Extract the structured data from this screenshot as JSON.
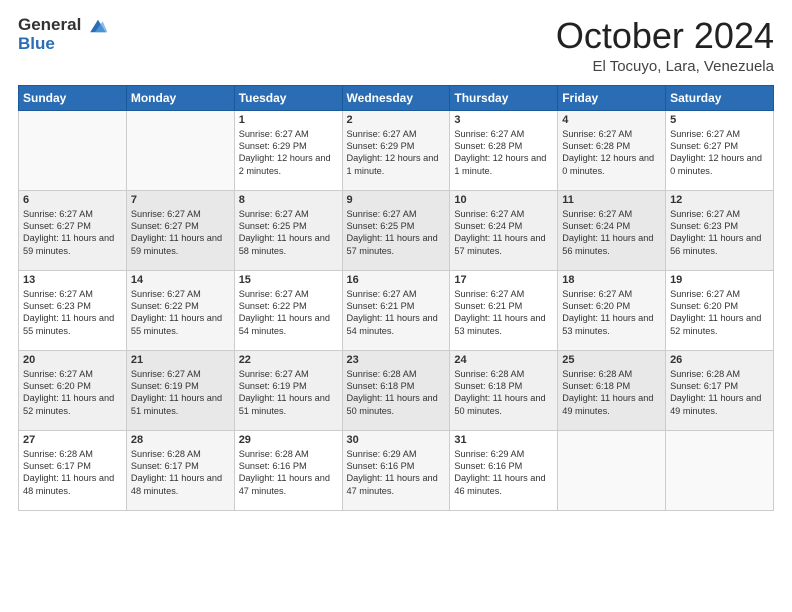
{
  "header": {
    "logo_general": "General",
    "logo_blue": "Blue",
    "month_title": "October 2024",
    "subtitle": "El Tocuyo, Lara, Venezuela"
  },
  "weekdays": [
    "Sunday",
    "Monday",
    "Tuesday",
    "Wednesday",
    "Thursday",
    "Friday",
    "Saturday"
  ],
  "weeks": [
    [
      {
        "day": "",
        "content": ""
      },
      {
        "day": "",
        "content": ""
      },
      {
        "day": "1",
        "content": "Sunrise: 6:27 AM\nSunset: 6:29 PM\nDaylight: 12 hours and 2 minutes."
      },
      {
        "day": "2",
        "content": "Sunrise: 6:27 AM\nSunset: 6:29 PM\nDaylight: 12 hours and 1 minute."
      },
      {
        "day": "3",
        "content": "Sunrise: 6:27 AM\nSunset: 6:28 PM\nDaylight: 12 hours and 1 minute."
      },
      {
        "day": "4",
        "content": "Sunrise: 6:27 AM\nSunset: 6:28 PM\nDaylight: 12 hours and 0 minutes."
      },
      {
        "day": "5",
        "content": "Sunrise: 6:27 AM\nSunset: 6:27 PM\nDaylight: 12 hours and 0 minutes."
      }
    ],
    [
      {
        "day": "6",
        "content": "Sunrise: 6:27 AM\nSunset: 6:27 PM\nDaylight: 11 hours and 59 minutes."
      },
      {
        "day": "7",
        "content": "Sunrise: 6:27 AM\nSunset: 6:27 PM\nDaylight: 11 hours and 59 minutes."
      },
      {
        "day": "8",
        "content": "Sunrise: 6:27 AM\nSunset: 6:25 PM\nDaylight: 11 hours and 58 minutes."
      },
      {
        "day": "9",
        "content": "Sunrise: 6:27 AM\nSunset: 6:25 PM\nDaylight: 11 hours and 57 minutes."
      },
      {
        "day": "10",
        "content": "Sunrise: 6:27 AM\nSunset: 6:24 PM\nDaylight: 11 hours and 57 minutes."
      },
      {
        "day": "11",
        "content": "Sunrise: 6:27 AM\nSunset: 6:24 PM\nDaylight: 11 hours and 56 minutes."
      },
      {
        "day": "12",
        "content": "Sunrise: 6:27 AM\nSunset: 6:23 PM\nDaylight: 11 hours and 56 minutes."
      }
    ],
    [
      {
        "day": "13",
        "content": "Sunrise: 6:27 AM\nSunset: 6:23 PM\nDaylight: 11 hours and 55 minutes."
      },
      {
        "day": "14",
        "content": "Sunrise: 6:27 AM\nSunset: 6:22 PM\nDaylight: 11 hours and 55 minutes."
      },
      {
        "day": "15",
        "content": "Sunrise: 6:27 AM\nSunset: 6:22 PM\nDaylight: 11 hours and 54 minutes."
      },
      {
        "day": "16",
        "content": "Sunrise: 6:27 AM\nSunset: 6:21 PM\nDaylight: 11 hours and 54 minutes."
      },
      {
        "day": "17",
        "content": "Sunrise: 6:27 AM\nSunset: 6:21 PM\nDaylight: 11 hours and 53 minutes."
      },
      {
        "day": "18",
        "content": "Sunrise: 6:27 AM\nSunset: 6:20 PM\nDaylight: 11 hours and 53 minutes."
      },
      {
        "day": "19",
        "content": "Sunrise: 6:27 AM\nSunset: 6:20 PM\nDaylight: 11 hours and 52 minutes."
      }
    ],
    [
      {
        "day": "20",
        "content": "Sunrise: 6:27 AM\nSunset: 6:20 PM\nDaylight: 11 hours and 52 minutes."
      },
      {
        "day": "21",
        "content": "Sunrise: 6:27 AM\nSunset: 6:19 PM\nDaylight: 11 hours and 51 minutes."
      },
      {
        "day": "22",
        "content": "Sunrise: 6:27 AM\nSunset: 6:19 PM\nDaylight: 11 hours and 51 minutes."
      },
      {
        "day": "23",
        "content": "Sunrise: 6:28 AM\nSunset: 6:18 PM\nDaylight: 11 hours and 50 minutes."
      },
      {
        "day": "24",
        "content": "Sunrise: 6:28 AM\nSunset: 6:18 PM\nDaylight: 11 hours and 50 minutes."
      },
      {
        "day": "25",
        "content": "Sunrise: 6:28 AM\nSunset: 6:18 PM\nDaylight: 11 hours and 49 minutes."
      },
      {
        "day": "26",
        "content": "Sunrise: 6:28 AM\nSunset: 6:17 PM\nDaylight: 11 hours and 49 minutes."
      }
    ],
    [
      {
        "day": "27",
        "content": "Sunrise: 6:28 AM\nSunset: 6:17 PM\nDaylight: 11 hours and 48 minutes."
      },
      {
        "day": "28",
        "content": "Sunrise: 6:28 AM\nSunset: 6:17 PM\nDaylight: 11 hours and 48 minutes."
      },
      {
        "day": "29",
        "content": "Sunrise: 6:28 AM\nSunset: 6:16 PM\nDaylight: 11 hours and 47 minutes."
      },
      {
        "day": "30",
        "content": "Sunrise: 6:29 AM\nSunset: 6:16 PM\nDaylight: 11 hours and 47 minutes."
      },
      {
        "day": "31",
        "content": "Sunrise: 6:29 AM\nSunset: 6:16 PM\nDaylight: 11 hours and 46 minutes."
      },
      {
        "day": "",
        "content": ""
      },
      {
        "day": "",
        "content": ""
      }
    ]
  ]
}
